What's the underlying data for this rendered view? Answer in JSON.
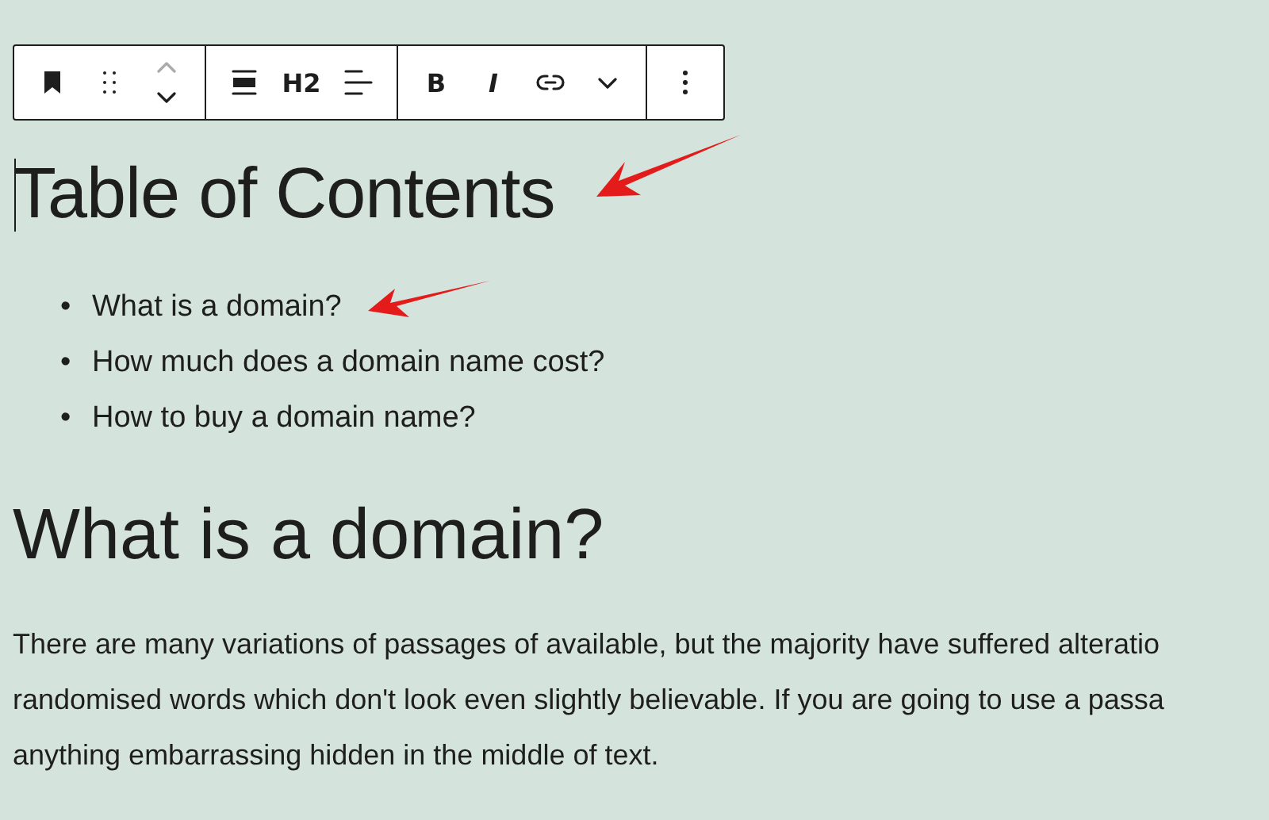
{
  "toolbar": {
    "groups": [
      {
        "items": [
          {
            "kind": "bookmark"
          },
          {
            "kind": "drag"
          },
          {
            "kind": "movers"
          }
        ]
      },
      {
        "items": [
          {
            "kind": "align-wide"
          },
          {
            "kind": "text",
            "label": "H2"
          },
          {
            "kind": "align-left"
          }
        ]
      },
      {
        "items": [
          {
            "kind": "text",
            "label": "B"
          },
          {
            "kind": "italic",
            "label": "I"
          },
          {
            "kind": "link"
          },
          {
            "kind": "chevron"
          }
        ]
      },
      {
        "items": [
          {
            "kind": "more"
          }
        ]
      }
    ]
  },
  "title": "Table of Contents",
  "toc": [
    {
      "marker": "•",
      "text": "What is a domain?"
    },
    {
      "marker": "•",
      "text": "How much does a domain name cost?"
    },
    {
      "marker": "•",
      "text": "How to buy a domain name?"
    }
  ],
  "heading": "What is a domain?",
  "paragraph_lines": [
    "There are many variations of passages of available, but the majority have suffered alteratio",
    "randomised words which don't look even slightly believable. If you are going to use a passa",
    "anything embarrassing hidden in the middle of text."
  ]
}
